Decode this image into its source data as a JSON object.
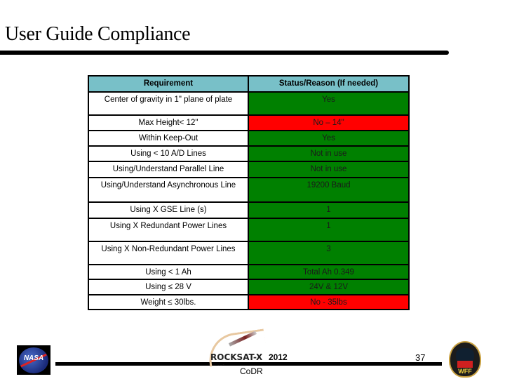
{
  "title": "User Guide Compliance",
  "table": {
    "headers": [
      "Requirement",
      "Status/Reason (If needed)"
    ],
    "rows": [
      {
        "requirement": "Center of gravity in 1\" plane of plate",
        "status": "Yes",
        "state": "pass"
      },
      {
        "requirement": "Max Height< 12\"",
        "status": "No – 14\"",
        "state": "fail"
      },
      {
        "requirement": "Within Keep-Out",
        "status": "Yes",
        "state": "pass"
      },
      {
        "requirement": "Using < 10 A/D Lines",
        "status": "Not in use",
        "state": "pass"
      },
      {
        "requirement": "Using/Understand Parallel Line",
        "status": "Not in use",
        "state": "pass"
      },
      {
        "requirement": "Using/Understand Asynchronous Line",
        "status": "19200 Baud",
        "state": "pass"
      },
      {
        "requirement": "Using X GSE Line (s)",
        "status": "1",
        "state": "pass"
      },
      {
        "requirement": "Using X Redundant Power Lines",
        "status": "1",
        "state": "pass"
      },
      {
        "requirement": "Using X Non-Redundant Power Lines",
        "status": "3",
        "state": "pass"
      },
      {
        "requirement": "Using < 1 Ah",
        "status": "Total Ah 0.349",
        "state": "pass"
      },
      {
        "requirement": "Using ≤ 28 V",
        "status": "24V & 12V",
        "state": "pass"
      },
      {
        "requirement": "Weight ≤ 30lbs.",
        "status": "No - 35lbs",
        "state": "fail"
      }
    ]
  },
  "colors": {
    "pass": "#008000",
    "fail": "#ff0000",
    "header": "#78c0c8"
  },
  "footer": {
    "nasa_logo": "NASA",
    "rocksat_logo": "ROCKSAT-X",
    "year": "2012",
    "event": "CoDR",
    "page_number": "37",
    "wff_logo": "WFF"
  }
}
